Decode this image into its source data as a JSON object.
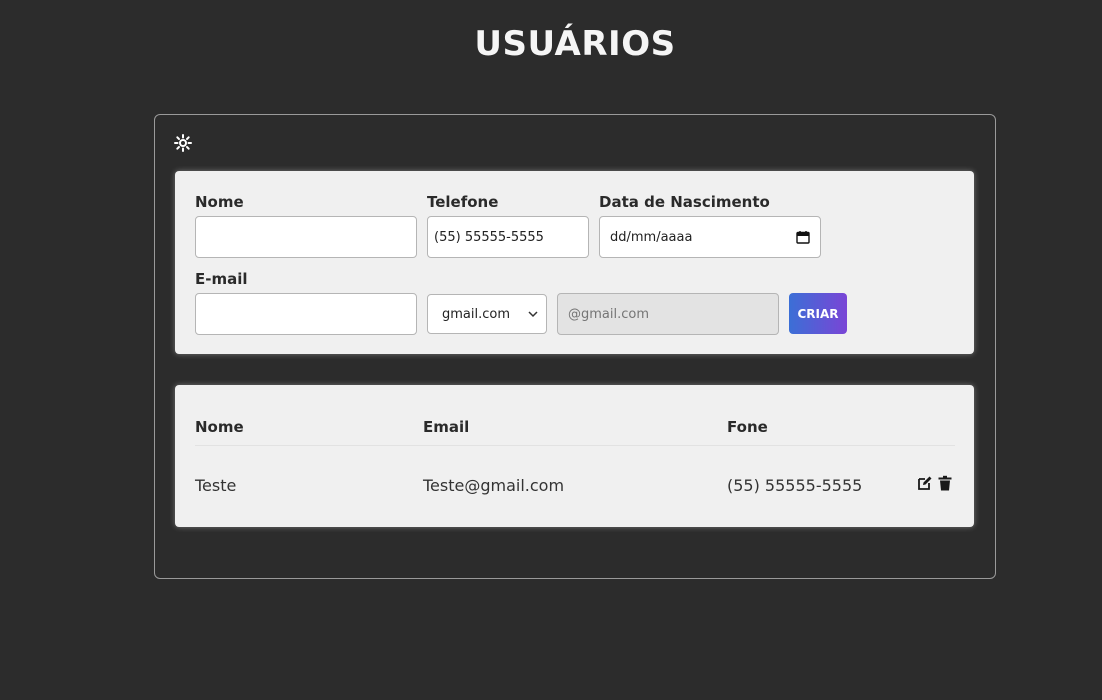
{
  "page": {
    "title": "USUÁRIOS"
  },
  "form": {
    "name_label": "Nome",
    "name_value": "",
    "phone_label": "Telefone",
    "phone_value": "(55) 55555-5555",
    "birth_label": "Data de Nascimento",
    "birth_placeholder": "dd/mm/aaaa",
    "email_label": "E-mail",
    "email_value": "",
    "domain_selected": "gmail.com",
    "email_preview_placeholder": "@gmail.com",
    "create_label": "CRIAR"
  },
  "table": {
    "headers": [
      "Nome",
      "Email",
      "Fone"
    ],
    "rows": [
      {
        "name": "Teste",
        "email": "Teste@gmail.com",
        "phone": "(55) 55555-5555"
      }
    ]
  },
  "icons": {
    "theme": "sun-icon",
    "edit": "edit-icon",
    "delete": "trash-icon",
    "select_arrow": "chevron-down-icon",
    "date_picker": "calendar-icon"
  },
  "colors": {
    "background": "#2c2c2c",
    "card": "#f0f0f0",
    "button_gradient_start": "#3b6fd6",
    "button_gradient_end": "#7a45d6"
  }
}
